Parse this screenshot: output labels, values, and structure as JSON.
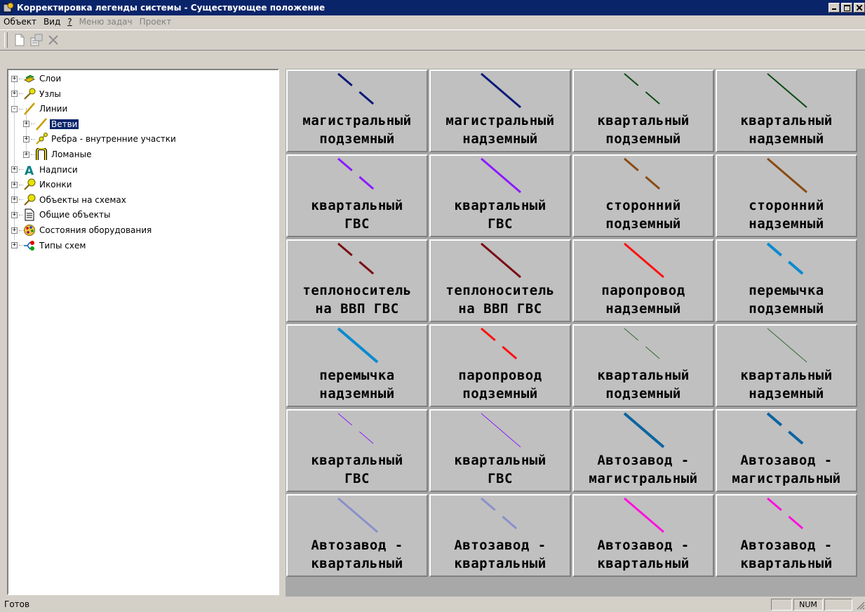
{
  "window": {
    "title": "Корректировка легенды системы - Существующее положение"
  },
  "menu": [
    {
      "label": "Объект",
      "state": "normal"
    },
    {
      "label": "Вид",
      "state": "normal"
    },
    {
      "label": "?",
      "state": "underline"
    },
    {
      "label": "Меню задач",
      "state": "disabled"
    },
    {
      "label": "Проект",
      "state": "disabled"
    }
  ],
  "toolbar": {
    "icons": [
      "new-document-icon",
      "properties-icon",
      "delete-icon"
    ]
  },
  "tree": [
    {
      "label": "Слои",
      "icon": "layers-icon",
      "level": 0,
      "expander": "+"
    },
    {
      "label": "Узлы",
      "icon": "nodes-icon",
      "level": 0,
      "expander": "+"
    },
    {
      "label": "Линии",
      "icon": "lines-icon",
      "level": 0,
      "expander": "-"
    },
    {
      "label": "Ветви",
      "icon": "branches-icon",
      "level": 1,
      "expander": "+",
      "selected": true
    },
    {
      "label": "Ребра - внутренние участки",
      "icon": "edges-icon",
      "level": 1,
      "expander": "+"
    },
    {
      "label": "Ломаные",
      "icon": "polylines-icon",
      "level": 1,
      "expander": "+"
    },
    {
      "label": "Надписи",
      "icon": "labels-icon",
      "level": 0,
      "expander": "+"
    },
    {
      "label": "Иконки",
      "icon": "icons-icon",
      "level": 0,
      "expander": "+"
    },
    {
      "label": "Объекты на схемах",
      "icon": "scheme-objects-icon",
      "level": 0,
      "expander": "+"
    },
    {
      "label": "Общие объекты",
      "icon": "common-objects-icon",
      "level": 0,
      "expander": "+"
    },
    {
      "label": "Состояния оборудования",
      "icon": "equipment-states-icon",
      "level": 0,
      "expander": "+"
    },
    {
      "label": "Типы схем",
      "icon": "scheme-types-icon",
      "level": 0,
      "expander": "+"
    }
  ],
  "legend": [
    {
      "l1": "магистральный",
      "l2": "подземный",
      "color": "#0a1a78",
      "style": "dashed",
      "width": 3
    },
    {
      "l1": "магистральный",
      "l2": "надземный",
      "color": "#0a1a78",
      "style": "solid",
      "width": 3
    },
    {
      "l1": "квартальный",
      "l2": "подземный",
      "color": "#0d4a14",
      "style": "dashed",
      "width": 2
    },
    {
      "l1": "квартальный",
      "l2": "надземный",
      "color": "#0d4a14",
      "style": "solid",
      "width": 2
    },
    {
      "l1": "квартальный",
      "l2": "ГВС",
      "color": "#8b1aff",
      "style": "dashed",
      "width": 3
    },
    {
      "l1": "квартальный",
      "l2": "ГВС",
      "color": "#8b1aff",
      "style": "solid",
      "width": 3
    },
    {
      "l1": "сторонний",
      "l2": "подземный",
      "color": "#8a4a12",
      "style": "dashed",
      "width": 3
    },
    {
      "l1": "сторонний",
      "l2": "надземный",
      "color": "#8a4a12",
      "style": "solid",
      "width": 3
    },
    {
      "l1": "теплоноситель",
      "l2": "на ВВП ГВС",
      "color": "#7a0a12",
      "style": "dashed",
      "width": 3
    },
    {
      "l1": "теплоноситель",
      "l2": "на ВВП ГВС",
      "color": "#7a0a12",
      "style": "solid",
      "width": 3
    },
    {
      "l1": "паропровод",
      "l2": "надземный",
      "color": "#ff1010",
      "style": "solid",
      "width": 3
    },
    {
      "l1": "перемычка",
      "l2": "подземный",
      "color": "#0a8ad0",
      "style": "dashed",
      "width": 4
    },
    {
      "l1": "перемычка",
      "l2": "надземный",
      "color": "#0a8ad0",
      "style": "solid",
      "width": 4
    },
    {
      "l1": "паропровод",
      "l2": "подземный",
      "color": "#ff1010",
      "style": "dashed",
      "width": 3
    },
    {
      "l1": "квартальный",
      "l2": "подземный",
      "color": "#2e6a32",
      "style": "dashed",
      "width": 1
    },
    {
      "l1": "квартальный",
      "l2": "надземный",
      "color": "#2e6a32",
      "style": "solid",
      "width": 1
    },
    {
      "l1": "квартальный",
      "l2": "ГВС",
      "color": "#8b1aff",
      "style": "dashed",
      "width": 1
    },
    {
      "l1": "квартальный",
      "l2": "ГВС",
      "color": "#8b1aff",
      "style": "solid",
      "width": 1
    },
    {
      "l1": "Автозавод -",
      "l2": "магистральный",
      "color": "#0c64a0",
      "style": "solid",
      "width": 4
    },
    {
      "l1": "Автозавод -",
      "l2": "магистральный",
      "color": "#0c64a0",
      "style": "dashed",
      "width": 4
    },
    {
      "l1": "Автозавод -",
      "l2": "квартальный",
      "color": "#8a90cc",
      "style": "solid",
      "width": 3
    },
    {
      "l1": "Автозавод -",
      "l2": "квартальный",
      "color": "#8a90cc",
      "style": "dashed",
      "width": 3
    },
    {
      "l1": "Автозавод -",
      "l2": "квартальный",
      "color": "#ff10e0",
      "style": "solid",
      "width": 3
    },
    {
      "l1": "Автозавод -",
      "l2": "квартальный",
      "color": "#ff10e0",
      "style": "dashed",
      "width": 3
    }
  ],
  "status": {
    "text": "Готов",
    "panel_num": "NUM"
  }
}
